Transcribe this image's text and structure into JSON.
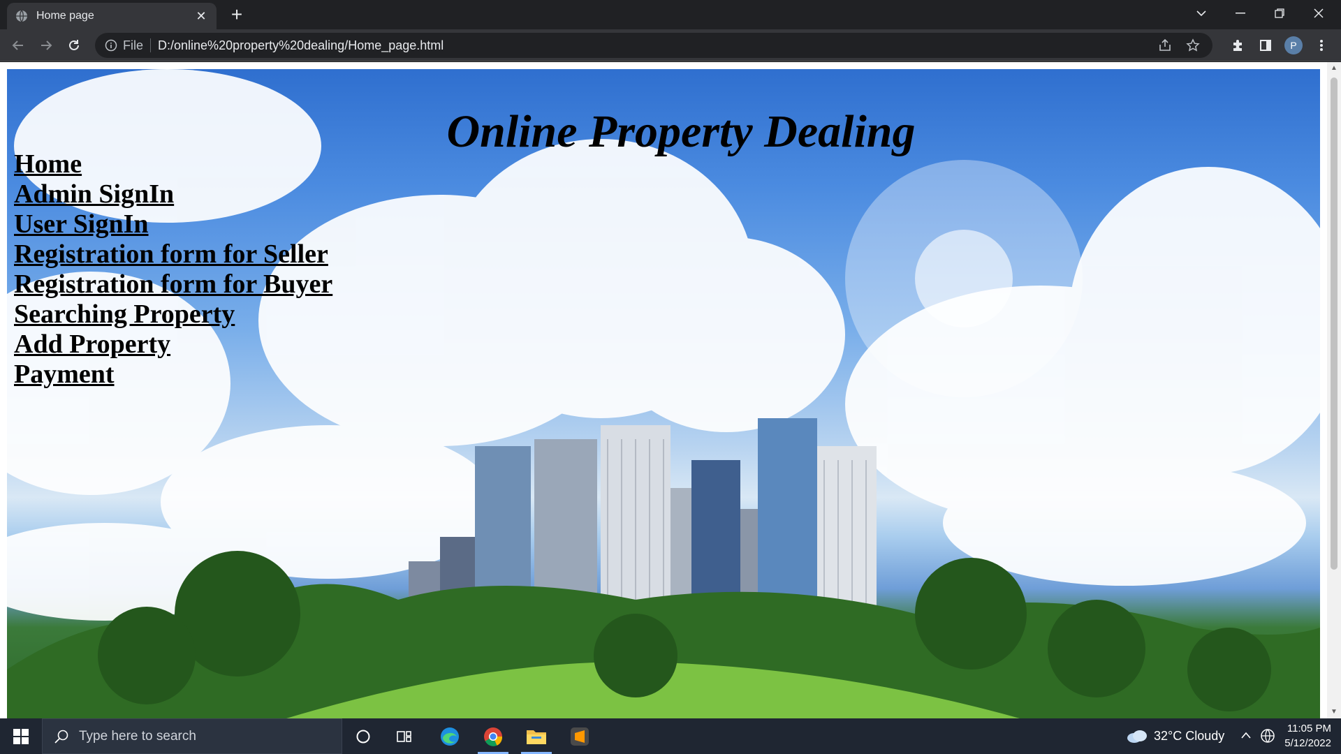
{
  "browser": {
    "tab_title": "Home page",
    "address": {
      "scheme_label": "File",
      "url": "D:/online%20property%20dealing/Home_page.html"
    },
    "profile_initial": "P"
  },
  "page": {
    "title": "Online Property Dealing",
    "nav_links": [
      {
        "label": "Home"
      },
      {
        "label": "Admin SignIn"
      },
      {
        "label": "User SignIn"
      },
      {
        "label": "Registration form for Seller"
      },
      {
        "label": "Registration form for Buyer"
      },
      {
        "label": "Searching Property"
      },
      {
        "label": "Add Property"
      },
      {
        "label": "Payment"
      }
    ]
  },
  "taskbar": {
    "search_placeholder": "Type here to search",
    "weather": "32°C  Cloudy",
    "time": "11:05 PM",
    "date": "5/12/2022",
    "apps": [
      "cortana-icon",
      "task-view-icon",
      "edge-icon",
      "chrome-icon",
      "file-explorer-icon",
      "sublime-text-icon"
    ]
  },
  "colors": {
    "chrome_dark": "#202124",
    "chrome_toolbar": "#35363a",
    "taskbar": "#1f2632"
  }
}
